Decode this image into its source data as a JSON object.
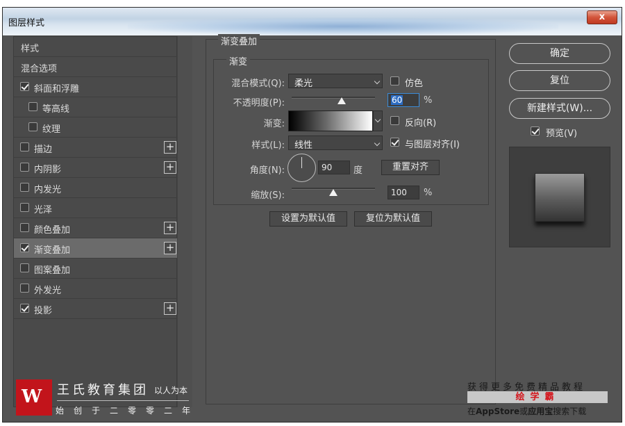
{
  "window": {
    "title": "图层样式",
    "close_label": "x"
  },
  "style_list": {
    "items": [
      {
        "label": "样式",
        "checkbox": false,
        "checked": false,
        "plus": false,
        "selected": false,
        "indent": 0
      },
      {
        "label": "混合选项",
        "checkbox": false,
        "checked": false,
        "plus": false,
        "selected": false,
        "indent": 0
      },
      {
        "label": "斜面和浮雕",
        "checkbox": true,
        "checked": true,
        "plus": false,
        "selected": false,
        "indent": 0
      },
      {
        "label": "等高线",
        "checkbox": true,
        "checked": false,
        "plus": false,
        "selected": false,
        "indent": 1
      },
      {
        "label": "纹理",
        "checkbox": true,
        "checked": false,
        "plus": false,
        "selected": false,
        "indent": 1
      },
      {
        "label": "描边",
        "checkbox": true,
        "checked": false,
        "plus": true,
        "selected": false,
        "indent": 0
      },
      {
        "label": "内阴影",
        "checkbox": true,
        "checked": false,
        "plus": true,
        "selected": false,
        "indent": 0
      },
      {
        "label": "内发光",
        "checkbox": true,
        "checked": false,
        "plus": false,
        "selected": false,
        "indent": 0
      },
      {
        "label": "光泽",
        "checkbox": true,
        "checked": false,
        "plus": false,
        "selected": false,
        "indent": 0
      },
      {
        "label": "颜色叠加",
        "checkbox": true,
        "checked": false,
        "plus": true,
        "selected": false,
        "indent": 0
      },
      {
        "label": "渐变叠加",
        "checkbox": true,
        "checked": true,
        "plus": true,
        "selected": true,
        "indent": 0
      },
      {
        "label": "图案叠加",
        "checkbox": true,
        "checked": false,
        "plus": false,
        "selected": false,
        "indent": 0
      },
      {
        "label": "外发光",
        "checkbox": true,
        "checked": false,
        "plus": false,
        "selected": false,
        "indent": 0
      },
      {
        "label": "投影",
        "checkbox": true,
        "checked": true,
        "plus": true,
        "selected": false,
        "indent": 0
      }
    ],
    "plus_label": "+"
  },
  "panel": {
    "outer_title": "渐变叠加",
    "inner_title": "渐变",
    "blend_mode": {
      "label": "混合模式(Q):",
      "value": "柔光"
    },
    "dither": {
      "label": "仿色",
      "checked": false
    },
    "opacity": {
      "label": "不透明度(P):",
      "value": "60",
      "unit": "%",
      "fraction": 0.6
    },
    "gradient": {
      "label": "渐变:"
    },
    "reverse": {
      "label": "反向(R)",
      "checked": false
    },
    "style": {
      "label": "样式(L):",
      "value": "线性"
    },
    "align": {
      "label": "与图层对齐(I)",
      "checked": true
    },
    "angle": {
      "label": "角度(N):",
      "value": "90",
      "unit": "度",
      "degrees": 90
    },
    "reset_align_label": "重置对齐",
    "scale": {
      "label": "缩放(S):",
      "value": "100",
      "unit": "%",
      "fraction": 0.5
    },
    "make_default_label": "设置为默认值",
    "reset_default_label": "复位为默认值"
  },
  "right": {
    "ok_label": "确定",
    "reset_label": "复位",
    "new_style_label": "新建样式(W)...",
    "preview": {
      "label": "预览(V)",
      "checked": true
    }
  },
  "watermark": {
    "logo_mark": "W",
    "brand": "王氏教育集团",
    "slogan": "以人为本",
    "founded": "始创于二零零二年",
    "promo_top": "获得更多免费精品教程",
    "promo_app": "绘学霸",
    "promo_bottom_pre": "在",
    "promo_bottom_store": "AppStore",
    "promo_bottom_mid": "或",
    "promo_bottom_app": "应用宝",
    "promo_bottom_post": "搜索下载"
  }
}
